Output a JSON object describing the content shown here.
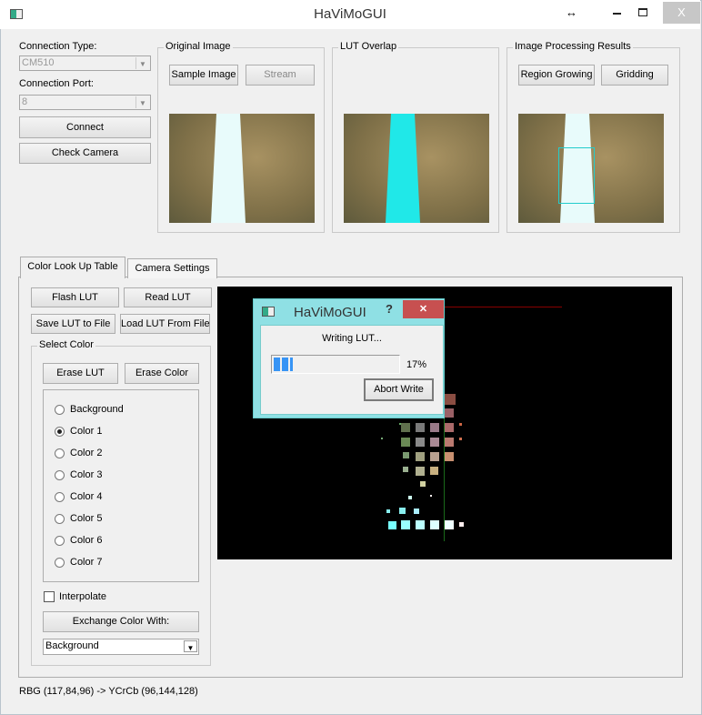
{
  "window": {
    "title": "HaViMoGUI",
    "resize_icon": "↔",
    "min_icon": "_",
    "max_icon": "☐",
    "close_icon": "X"
  },
  "connection": {
    "type_label": "Connection Type:",
    "type_value": "CM510",
    "port_label": "Connection Port:",
    "port_value": "8",
    "connect": "Connect",
    "check_camera": "Check Camera"
  },
  "original": {
    "label": "Original Image",
    "sample": "Sample Image",
    "stream": "Stream"
  },
  "lut_overlap": {
    "label": "LUT Overlap"
  },
  "results": {
    "label": "Image Processing Results",
    "region": "Region Growing",
    "gridding": "Gridding"
  },
  "tabs": [
    {
      "label": "Color Look Up Table"
    },
    {
      "label": "Camera Settings"
    }
  ],
  "lut": {
    "flash": "Flash LUT",
    "read": "Read LUT",
    "save": "Save LUT to File",
    "load": "Load LUT From File"
  },
  "select_color": {
    "label": "Select Color",
    "erase_lut": "Erase LUT",
    "erase_color": "Erase Color",
    "options": [
      "Background",
      "Color 1",
      "Color 2",
      "Color 3",
      "Color 4",
      "Color 5",
      "Color 6",
      "Color 7"
    ],
    "selected": "Color 1",
    "interpolate": "Interpolate",
    "interpolate_checked": false,
    "exchange": "Exchange Color With:",
    "exchange_value": "Background"
  },
  "status": "RBG (117,84,96) -> YCrCb (96,144,128)",
  "dialog": {
    "title": "HaViMoGUI",
    "help": "?",
    "close": "✕",
    "message": "Writing LUT...",
    "progress": 17,
    "progress_text": "17%",
    "abort": "Abort Write"
  }
}
